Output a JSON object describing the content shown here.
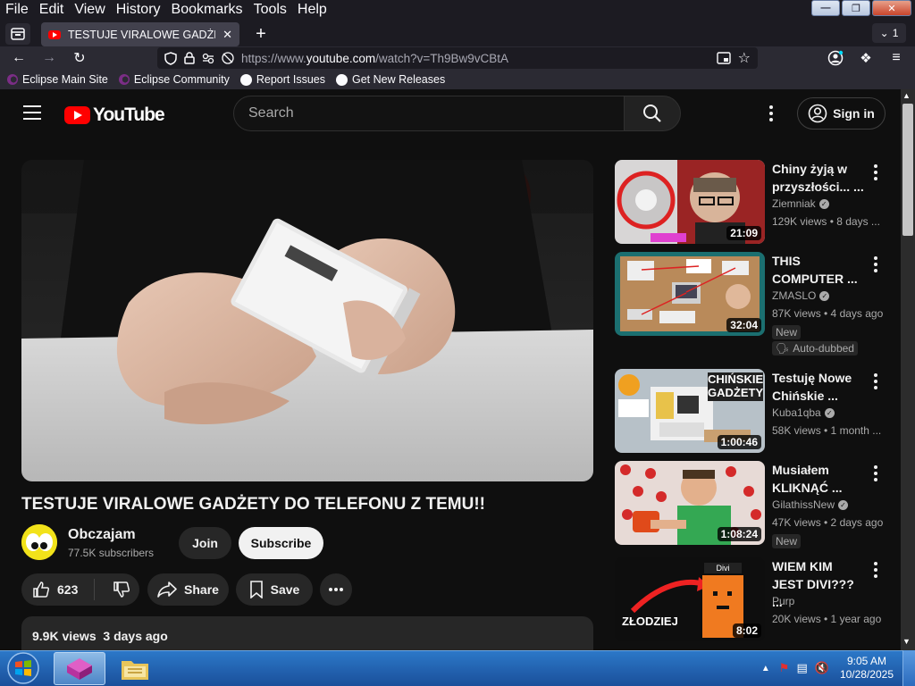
{
  "browser": {
    "menu": [
      "File",
      "Edit",
      "View",
      "History",
      "Bookmarks",
      "Tools",
      "Help"
    ],
    "tab_title": "TESTUJE VIRALOWE GADŻETY D",
    "tab_count": "1",
    "url_prefix": "https://www.",
    "url_host": "youtube.com",
    "url_path": "/watch?v=Th9Bw9vCBtA",
    "bookmarks": [
      {
        "label": "Eclipse Main Site",
        "icon": "eclipse-icon"
      },
      {
        "label": "Eclipse Community",
        "icon": "eclipse-icon"
      },
      {
        "label": "Report Issues",
        "icon": "github-icon"
      },
      {
        "label": "Get New Releases",
        "icon": "github-icon"
      }
    ]
  },
  "youtube": {
    "logo_text": "YouTube",
    "search_placeholder": "Search",
    "signin_label": "Sign in",
    "video": {
      "title": "TESTUJE VIRALOWE GADŻETY DO TELEFONU Z TEMU!!",
      "channel": "Obczajam",
      "subscribers": "77.5K subscribers",
      "join_label": "Join",
      "subscribe_label": "Subscribe",
      "likes": "623",
      "share_label": "Share",
      "save_label": "Save",
      "views": "9.9K views",
      "date": "3 days ago"
    },
    "recommendations": [
      {
        "title_lines": [
          "Chiny żyją w",
          "przyszłości... ..."
        ],
        "channel": "Ziemniak",
        "verified": true,
        "meta": "129K views • 8 days ...",
        "duration": "21:09",
        "badges": []
      },
      {
        "title_lines": [
          "THIS",
          "COMPUTER ..."
        ],
        "channel": "ZMASLO",
        "verified": true,
        "meta": "87K views • 4 days ago",
        "duration": "32:04",
        "badges": [
          "New",
          "Auto-dubbed"
        ]
      },
      {
        "title_lines": [
          "Testuję Nowe",
          "Chińskie ..."
        ],
        "channel": "Kuba1qba",
        "verified": true,
        "meta": "58K views • 1 month ...",
        "duration": "1:00:46",
        "badges": []
      },
      {
        "title_lines": [
          "Musiałem",
          "KLIKNĄĆ ..."
        ],
        "channel": "GilathissNew",
        "verified": true,
        "meta": "47K views • 2 days ago",
        "duration": "1:08:24",
        "badges": [
          "New"
        ]
      },
      {
        "title_lines": [
          "WIEM KIM",
          "JEST DIVI??? ..."
        ],
        "channel": "Purp",
        "verified": false,
        "meta": "20K views • 1 year ago",
        "duration": "8:02",
        "badges": []
      }
    ],
    "thumb_texts": {
      "t3_big": "CHIŃSKIE GADŻETY",
      "t5_big": "ZŁODZIEJ",
      "t5_small": "Divi"
    }
  },
  "taskbar": {
    "time": "9:05 AM",
    "date": "10/28/2025"
  }
}
